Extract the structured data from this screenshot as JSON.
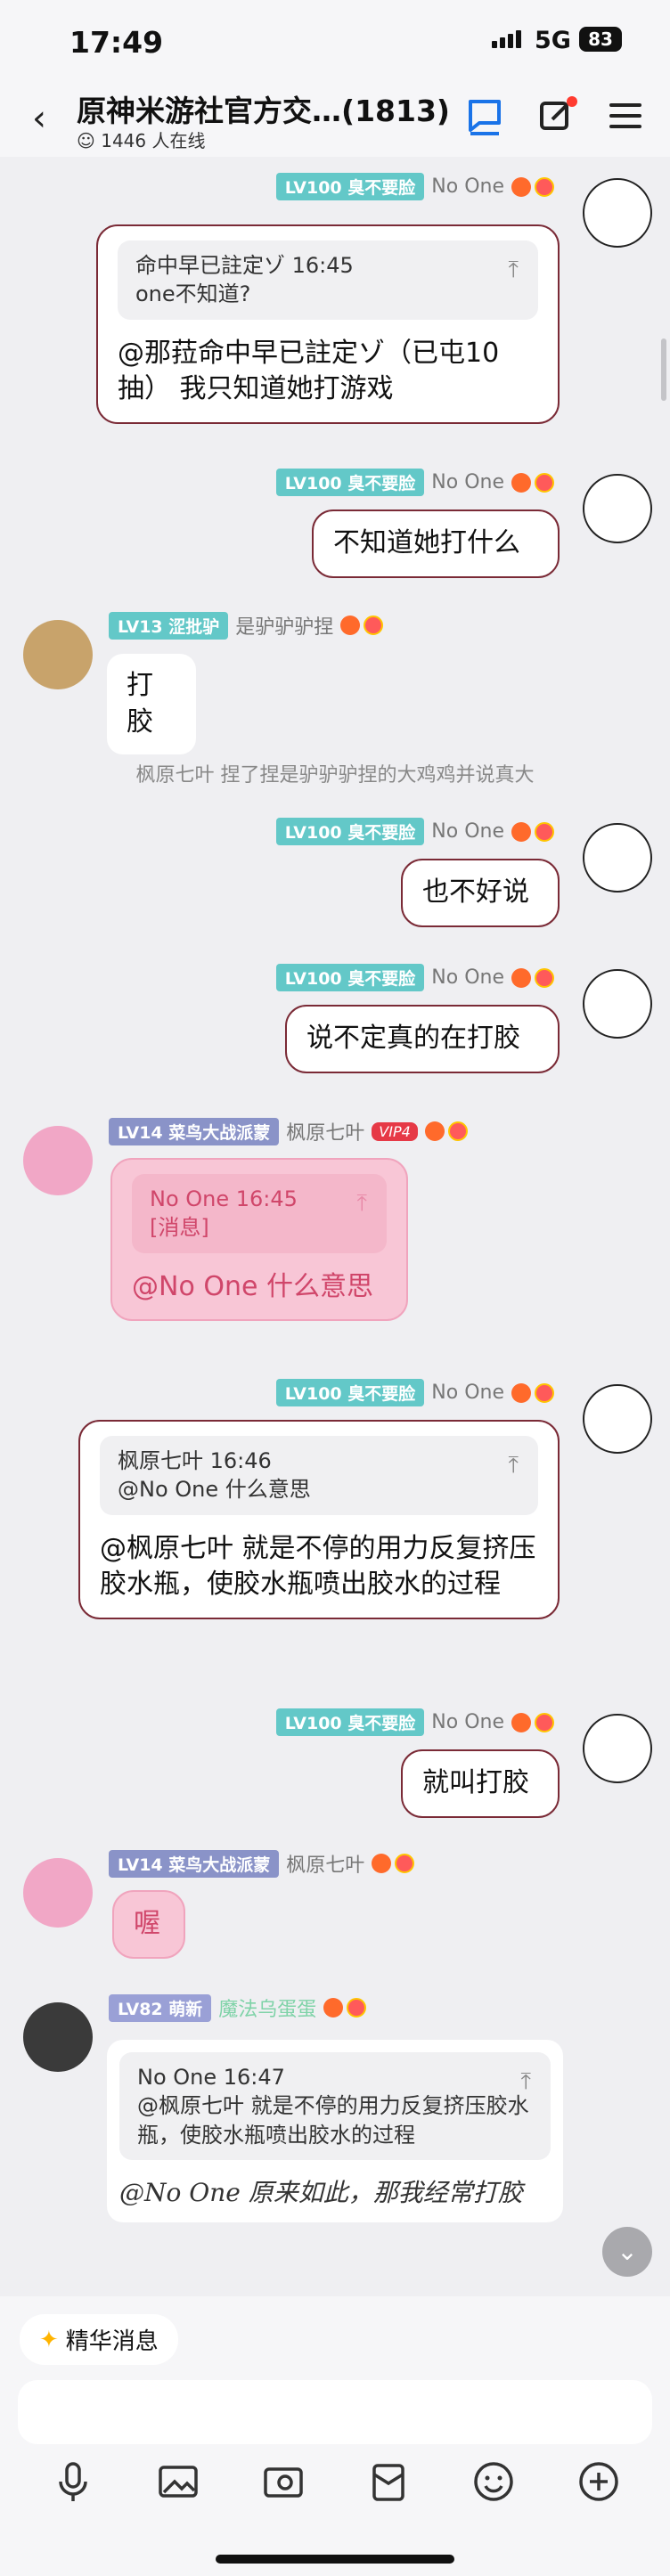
{
  "status": {
    "time": "17:49",
    "network": "5G",
    "battery": "83"
  },
  "header": {
    "title": "原神米游社官方交…(1813)",
    "online": "1446 人在线"
  },
  "messages": {
    "m1": {
      "level": "LV100",
      "title": "臭不要脸",
      "nick": "No One",
      "quote_head": "命中早已註定ゾ 16:45",
      "quote_body": "one不知道?",
      "text": "@那菈命中早已註定ゾ（已屯10抽） 我只知道她打游戏"
    },
    "m2": {
      "level": "LV100",
      "title": "臭不要脸",
      "nick": "No One",
      "text": "不知道她打什么"
    },
    "m3": {
      "level": "LV13",
      "title": "涩批驴",
      "nick": "是驴驴驴捏",
      "text": "打胶"
    },
    "sys1": {
      "text": "枫原七叶 捏了捏是驴驴驴捏的大鸡鸡并说真大"
    },
    "m4": {
      "level": "LV100",
      "title": "臭不要脸",
      "nick": "No One",
      "text": "也不好说"
    },
    "m5": {
      "level": "LV100",
      "title": "臭不要脸",
      "nick": "No One",
      "text": "说不定真的在打胶"
    },
    "m6": {
      "level": "LV14",
      "title": "菜鸟大战派蒙",
      "nick": "枫原七叶",
      "vip": "VIP4",
      "quote_head": "No One 16:45",
      "quote_body": "[消息]",
      "text": "@No One 什么意思"
    },
    "m7": {
      "level": "LV100",
      "title": "臭不要脸",
      "nick": "No One",
      "quote_head": "枫原七叶 16:46",
      "quote_body": "@No One 什么意思",
      "text": "@枫原七叶 就是不停的用力反复挤压胶水瓶，使胶水瓶喷出胶水的过程"
    },
    "m8": {
      "level": "LV100",
      "title": "臭不要脸",
      "nick": "No One",
      "text": "就叫打胶"
    },
    "m9": {
      "level": "LV14",
      "title": "菜鸟大战派蒙",
      "nick": "枫原七叶",
      "text": "喔"
    },
    "m10": {
      "level": "LV82",
      "title": "萌新",
      "nick": "魔法乌蛋蛋",
      "quote_head": "No One 16:47",
      "quote_body": "@枫原七叶 就是不停的用力反复挤压胶水瓶，使胶水瓶喷出胶水的过程",
      "text": "@No One 原来如此，那我经常打胶"
    }
  },
  "bottom": {
    "essence": "精华消息"
  },
  "colors": {
    "accent": "#1a73e8",
    "bubble_border": "#7a2a36",
    "level_teal": "#63c8c8"
  }
}
